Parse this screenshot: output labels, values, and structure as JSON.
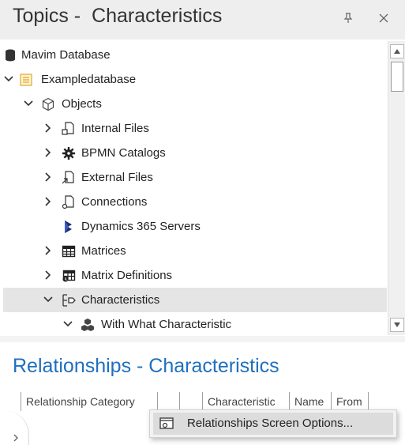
{
  "topics_panel": {
    "title": "Topics -  Characteristics",
    "pin_icon": "pin-icon",
    "close_icon": "close-icon"
  },
  "tree": {
    "items": [
      {
        "label": "Mavim Database",
        "icon": "database-icon",
        "expand": "none"
      },
      {
        "label": "Exampledatabase",
        "icon": "folder-db-icon",
        "expand": "expanded"
      },
      {
        "label": "Objects",
        "icon": "cube-icon",
        "expand": "expanded"
      },
      {
        "label": "Internal Files",
        "icon": "internal-files-icon",
        "expand": "collapsed"
      },
      {
        "label": "BPMN Catalogs",
        "icon": "gear-icon",
        "expand": "collapsed"
      },
      {
        "label": "External Files",
        "icon": "external-files-icon",
        "expand": "collapsed"
      },
      {
        "label": "Connections",
        "icon": "connections-icon",
        "expand": "collapsed"
      },
      {
        "label": "Dynamics 365 Servers",
        "icon": "dynamics-icon",
        "expand": "none"
      },
      {
        "label": "Matrices",
        "icon": "matrix-icon",
        "expand": "collapsed"
      },
      {
        "label": "Matrix Definitions",
        "icon": "matrix-definitions-icon",
        "expand": "collapsed"
      },
      {
        "label": "Characteristics",
        "icon": "characteristics-icon",
        "expand": "expanded",
        "selected": true
      },
      {
        "label": "With What Characteristic",
        "icon": "cubes-icon",
        "expand": "expanded"
      }
    ]
  },
  "relationships_panel": {
    "title": "Relationships - Characteristics",
    "columns": [
      "Relationship Category",
      "",
      "",
      "Characteristic",
      "Name",
      "From"
    ]
  },
  "context_menu": {
    "items": [
      {
        "label": "Relationships Screen Options...",
        "icon": "screen-options-icon"
      }
    ]
  },
  "colors": {
    "accent": "#1f6fbf",
    "folder": "#e8b84a",
    "selected_row": "#e5e5e5"
  }
}
